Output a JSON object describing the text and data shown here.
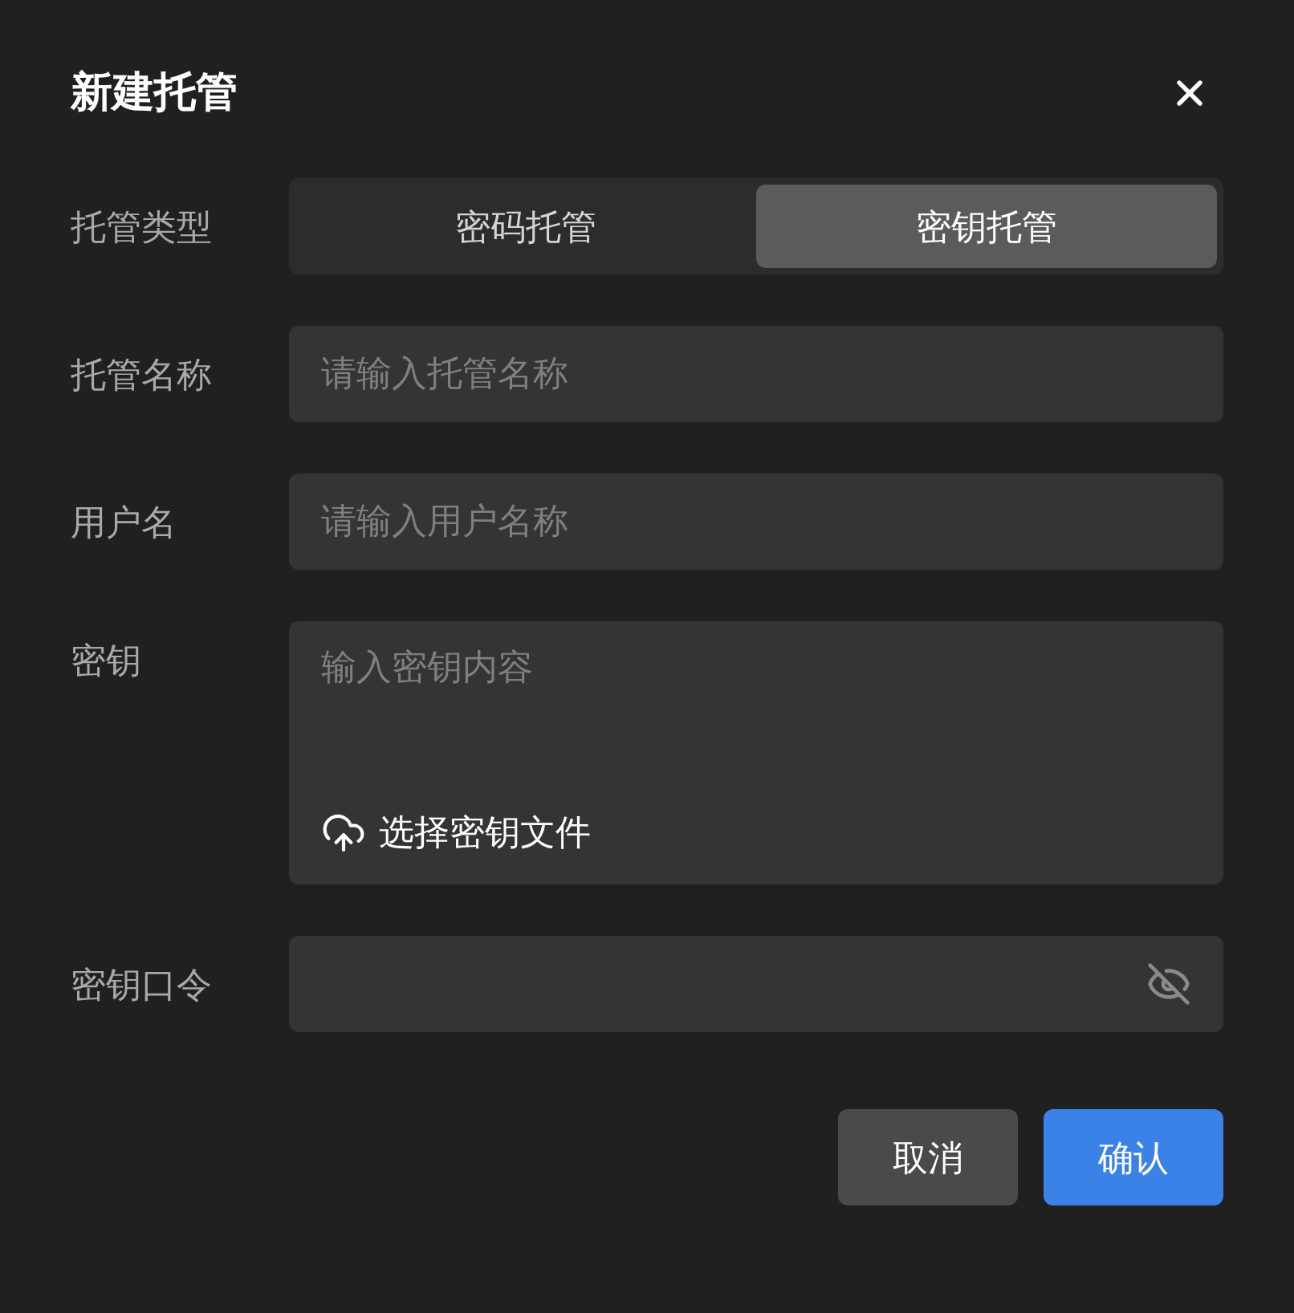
{
  "dialog": {
    "title": "新建托管"
  },
  "fields": [
    {
      "kind": "segmented",
      "label": "托管类型",
      "options": [
        {
          "label": "密码托管",
          "selected": false
        },
        {
          "label": "密钥托管",
          "selected": true
        }
      ]
    },
    {
      "kind": "input",
      "label": "托管名称",
      "placeholder": "请输入托管名称"
    },
    {
      "kind": "input",
      "label": "用户名",
      "placeholder": "请输入用户名称"
    },
    {
      "kind": "textarea",
      "label": "密钥",
      "placeholder": "输入密钥内容",
      "upload": "选择密钥文件"
    },
    {
      "kind": "password",
      "label": "密钥口令"
    }
  ],
  "buttons": [
    {
      "label": "取消",
      "primary": false
    },
    {
      "label": "确认",
      "primary": true
    }
  ]
}
